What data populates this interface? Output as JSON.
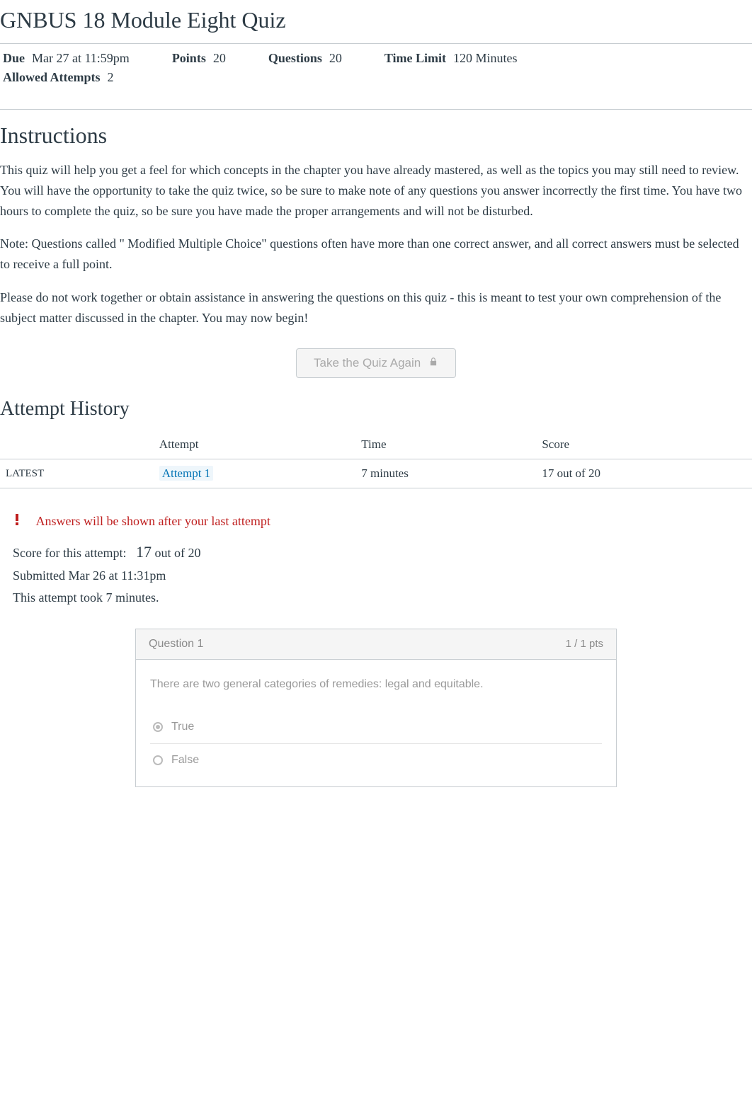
{
  "title": "GNBUS 18 Module Eight Quiz",
  "meta": {
    "dueLabel": "Due",
    "dueValue": "Mar 27 at 11:59pm",
    "pointsLabel": "Points",
    "pointsValue": "20",
    "questionsLabel": "Questions",
    "questionsValue": "20",
    "timeLimitLabel": "Time Limit",
    "timeLimitValue": "120 Minutes",
    "attemptsLabel": "Allowed Attempts",
    "attemptsValue": "2"
  },
  "instructions": {
    "heading": "Instructions",
    "p1": "This quiz will help you get a feel for which concepts in the chapter you have already mastered, as well as the topics you may still need to review.        You will have the opportunity to take the quiz twice, so be sure to make note of any questions you answer incorrectly the first time.           You have two hours to complete the quiz, so be sure you have made the proper arrangements and will not be disturbed.",
    "p2": "Note: Questions called \" Modified Multiple Choice\" questions often have more than one correct answer, and all correct answers must be selected to receive a full point.",
    "p3": "Please do not work together or obtain assistance in answering the questions on this quiz - this is meant to test your own comprehension of the subject matter discussed in the chapter.                   You may now begin!"
  },
  "takeQuizLabel": "Take the Quiz Again",
  "history": {
    "heading": "Attempt History",
    "cols": {
      "attempt": "Attempt",
      "time": "Time",
      "score": "Score"
    },
    "rowLatest": "LATEST",
    "rowAttempt": "Attempt 1",
    "rowTime": "7 minutes",
    "rowScore": "17 out of 20"
  },
  "alert": "Answers will be shown after your last attempt",
  "scoreBlock": {
    "scoreLabel": "Score for this attempt:",
    "scoreNum": "17",
    "scoreOf": "out of 20",
    "submitted": "Submitted Mar 26 at 11:31pm",
    "took": "This attempt took 7 minutes."
  },
  "question": {
    "label": "Question 1",
    "pts": "1 / 1 pts",
    "text": "There are two general categories of remedies: legal and equitable.",
    "a1": "True",
    "a2": "False"
  }
}
